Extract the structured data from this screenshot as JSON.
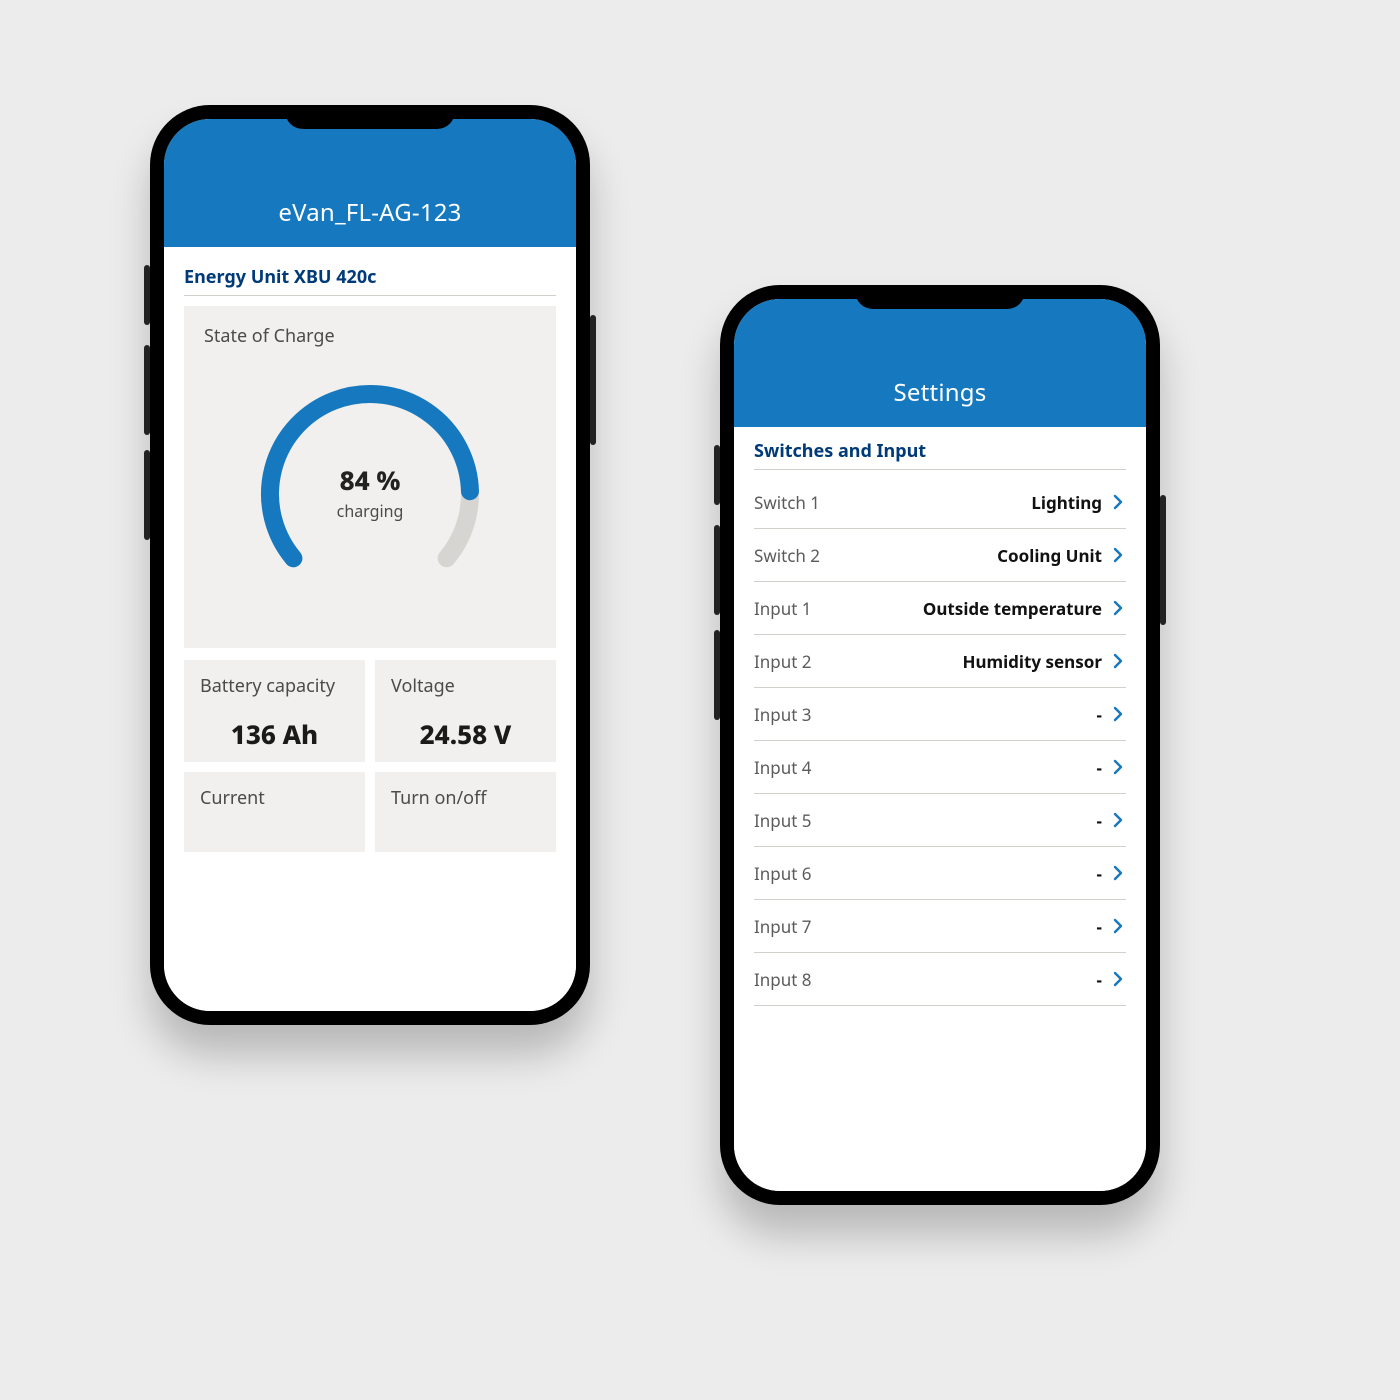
{
  "colors": {
    "accent": "#1679bf",
    "section_title": "#003a78",
    "tile_bg": "#f1f0ee"
  },
  "left": {
    "appbar_title": "eVan_FL-AG-123",
    "section_title": "Energy Unit XBU 420c",
    "soc": {
      "label": "State of Charge",
      "percent_text": "84 %",
      "percent_value": 84,
      "status": "charging"
    },
    "tiles": {
      "battery_capacity": {
        "label": "Battery capacity",
        "value": "136 Ah"
      },
      "voltage": {
        "label": "Voltage",
        "value": "24.58 V"
      },
      "current": {
        "label": "Current"
      },
      "power_toggle": {
        "label": "Turn on/off"
      }
    }
  },
  "right": {
    "appbar_title": "Settings",
    "section_title": "Switches and Input",
    "rows": [
      {
        "label": "Switch 1",
        "value": "Lighting"
      },
      {
        "label": "Switch 2",
        "value": "Cooling Unit"
      },
      {
        "label": "Input 1",
        "value": "Outside temperature"
      },
      {
        "label": "Input 2",
        "value": "Humidity sensor"
      },
      {
        "label": "Input 3",
        "value": "-"
      },
      {
        "label": "Input 4",
        "value": "-"
      },
      {
        "label": "Input 5",
        "value": "-"
      },
      {
        "label": "Input 6",
        "value": "-"
      },
      {
        "label": "Input 7",
        "value": "-"
      },
      {
        "label": "Input 8",
        "value": "-"
      }
    ]
  },
  "chart_data": {
    "type": "gauge",
    "title": "State of Charge",
    "value": 84,
    "min": 0,
    "max": 100,
    "unit": "%",
    "status": "charging",
    "arc_start_deg": 220,
    "arc_end_deg": -40,
    "track_color": "#d7d5d2",
    "fill_color": "#1679bf"
  }
}
